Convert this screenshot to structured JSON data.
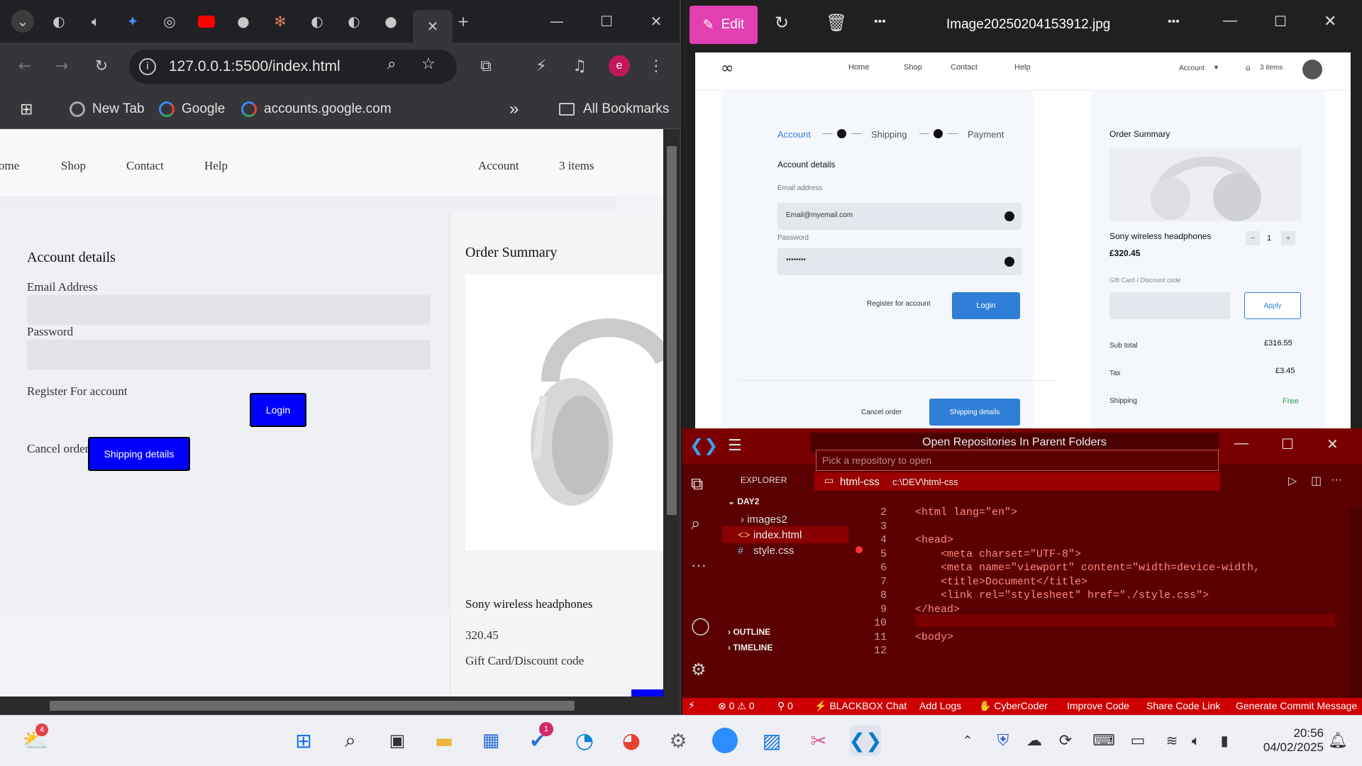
{
  "browser": {
    "url": "127.0.0.1:5500/index.html",
    "profile_initial": "e",
    "bookmarks": [
      "New Tab",
      "Google",
      "accounts.google.com"
    ],
    "all_bookmarks": "All Bookmarks",
    "overflow": "»",
    "page": {
      "nav": [
        "ome",
        "Shop",
        "Contact",
        "Help"
      ],
      "nav_right": [
        "Account",
        "3 items"
      ],
      "account_title": "Account details",
      "email_label": "Email Address",
      "password_label": "Password",
      "register": "Register For account",
      "login": "Login",
      "cancel": "Cancel order",
      "shipping_btn": "Shipping details",
      "summary_title": "Order Summary",
      "product_name": "Sony wireless headphones",
      "price": "320.45",
      "gift": "Gift Card/Discount code"
    }
  },
  "photos": {
    "edit_label": "Edit",
    "filename": "Image20250204153912.jpg",
    "menu_dots": "•••",
    "design": {
      "nav": [
        "Home",
        "Shop",
        "Contact",
        "Help"
      ],
      "account_menu": "Account",
      "cart": "3 items",
      "steps": [
        "Account",
        "Shipping",
        "Payment"
      ],
      "account_title": "Account details",
      "email_label": "Email address",
      "email_value": "Email@myemail.com",
      "password_label": "Password",
      "password_value": "••••••••",
      "register": "Register for account",
      "login": "Login",
      "cancel": "Cancel order",
      "shipping_btn": "Shipping details",
      "summary_title": "Order Summary",
      "product_name": "Sony wireless headphones",
      "price": "£320.45",
      "qty": "1",
      "qty_minus": "−",
      "qty_plus": "+",
      "gift_label": "Gift Card / Discount code",
      "apply": "Apply",
      "subtotal_label": "Sub total",
      "subtotal": "£316.55",
      "tax_label": "Tax",
      "tax": "£3.45",
      "shipping_label": "Shipping",
      "shipping_value": "Free"
    }
  },
  "vscode": {
    "title": "Open Repositories In Parent Folders",
    "placeholder": "Pick a repository to open",
    "repo_name": "html-css",
    "repo_path": "c:\\DEV\\html-css",
    "explorer": "EXPLORER",
    "folder": "DAY2",
    "files": [
      "images2",
      "index.html",
      "style.css"
    ],
    "outline": "OUTLINE",
    "timeline": "TIMELINE",
    "line_numbers": [
      "2",
      "3",
      "4",
      "5",
      "6",
      "7",
      "8",
      "9",
      "10",
      "11",
      "12"
    ],
    "code": [
      "<html lang=\"en\">",
      "",
      "<head>",
      "    <meta charset=\"UTF-8\">",
      "    <meta name=\"viewport\" content=\"width=device-width,",
      "    <title>Document</title>",
      "    <link rel=\"stylesheet\" href=\"./style.css\">",
      "</head>",
      "",
      "<body>",
      ""
    ],
    "status": {
      "errors": "0",
      "warnings": "0",
      "ports": "0",
      "items": [
        "BLACKBOX Chat",
        "Add Logs",
        "CyberCoder",
        "Improve Code",
        "Share Code Link",
        "Generate Commit Message"
      ]
    }
  },
  "taskbar": {
    "weather_badge": "4",
    "todo_badge": "1",
    "time": "20:56",
    "date": "04/02/2025"
  }
}
